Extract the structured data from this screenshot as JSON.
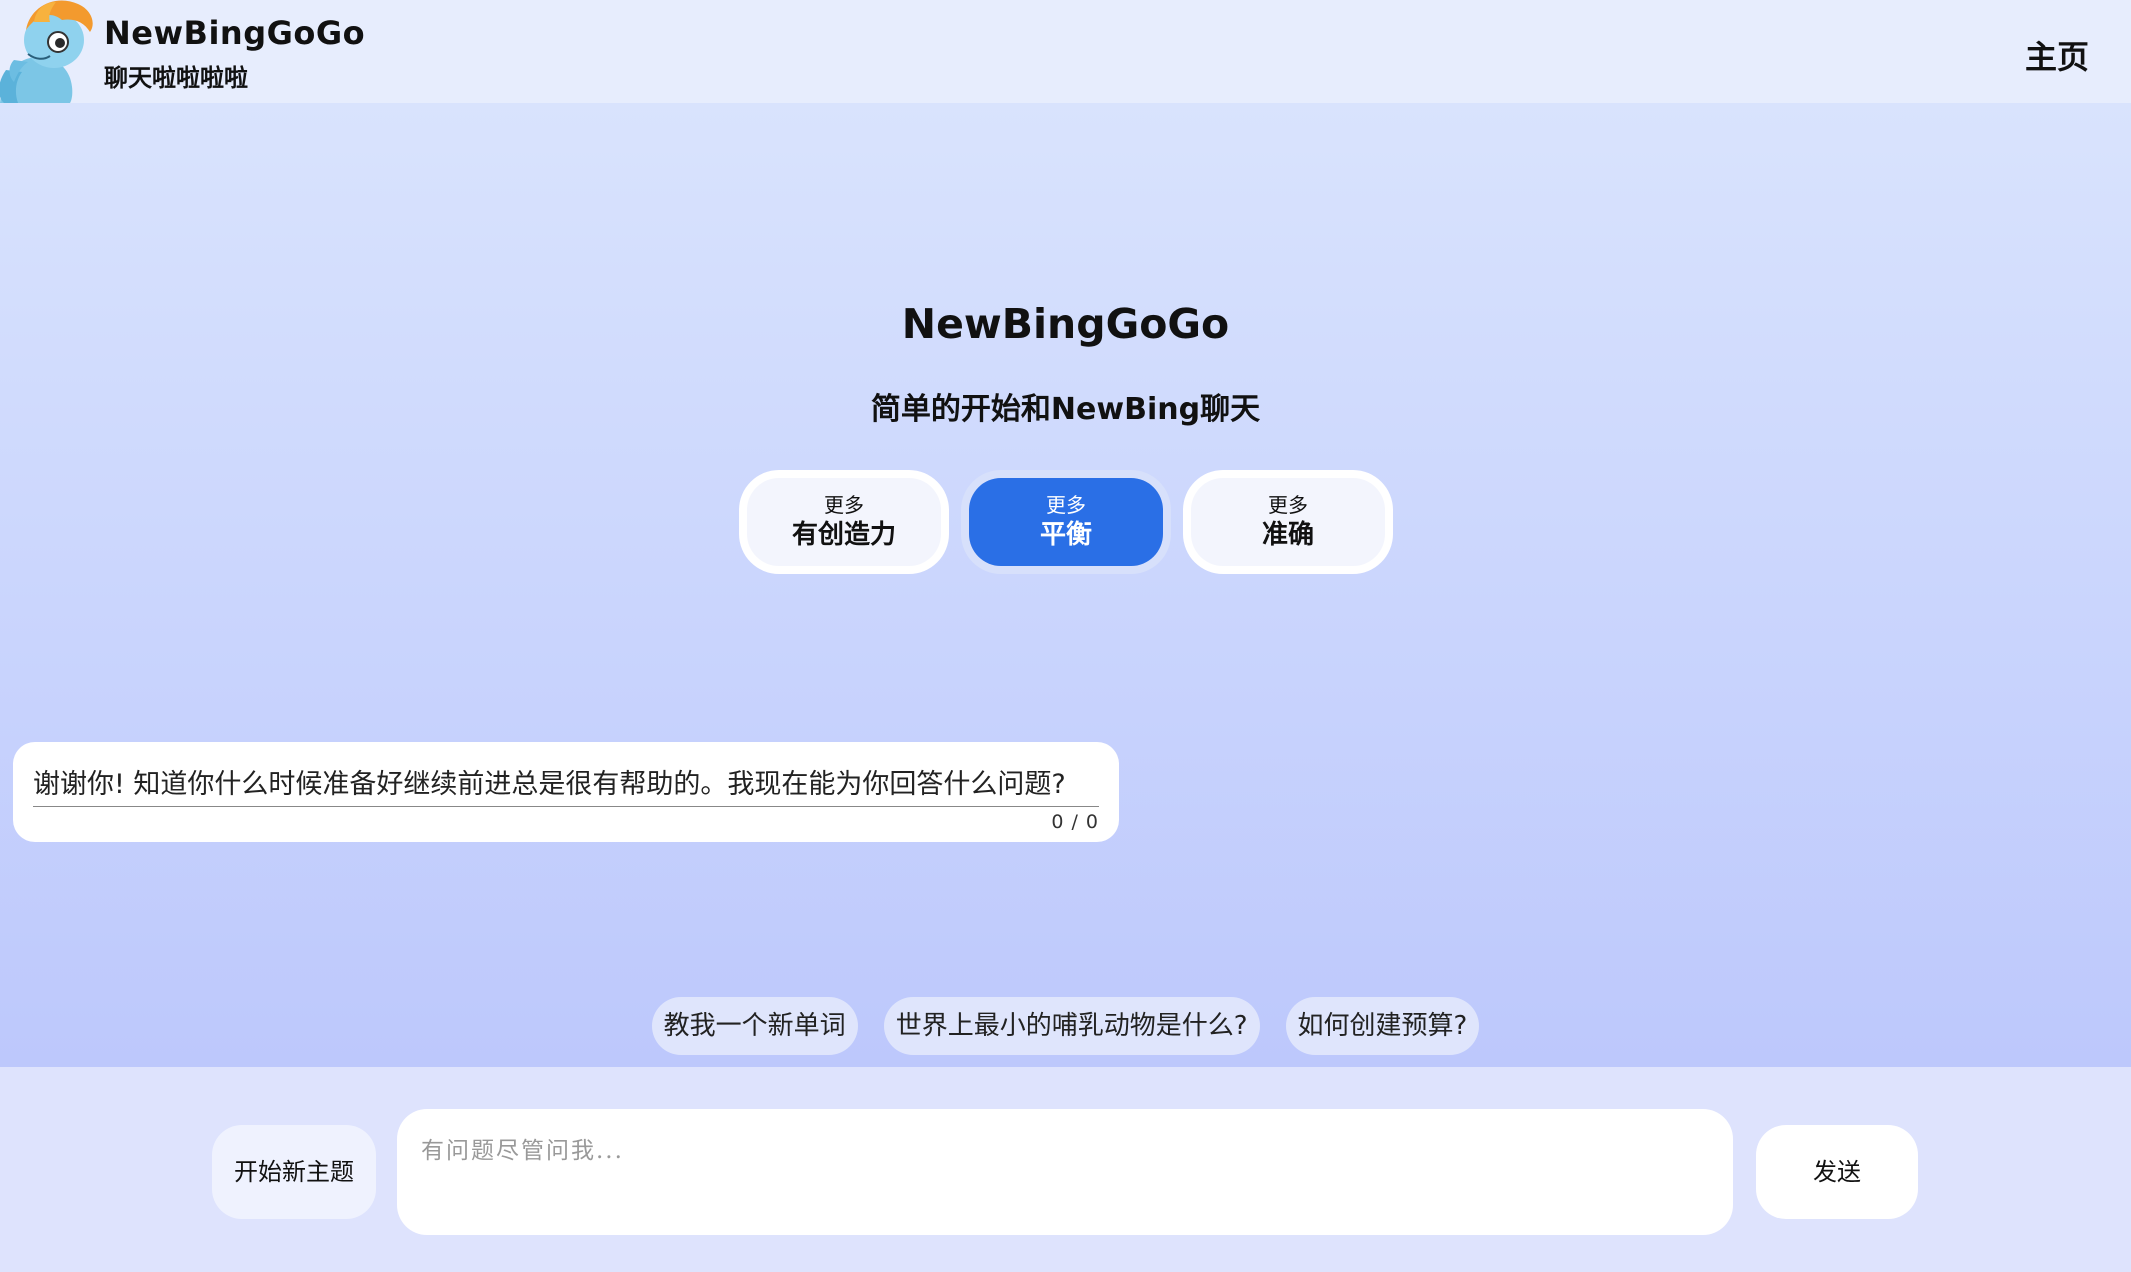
{
  "header": {
    "title": "NewBingGoGo",
    "subtitle": "聊天啦啦啦啦",
    "home_label": "主页"
  },
  "hero": {
    "title": "NewBingGoGo",
    "subtitle": "简单的开始和NewBing聊天"
  },
  "tones": [
    {
      "top": "更多",
      "label": "有创造力",
      "active": false
    },
    {
      "top": "更多",
      "label": "平衡",
      "active": true
    },
    {
      "top": "更多",
      "label": "准确",
      "active": false
    }
  ],
  "chat": {
    "message": "谢谢你! 知道你什么时候准备好继续前进总是很有帮助的。我现在能为你回答什么问题?",
    "count": "0 / 0"
  },
  "suggestions": [
    "教我一个新单词",
    "世界上最小的哺乳动物是什么?",
    "如何创建预算?"
  ],
  "composer": {
    "new_topic_label": "开始新主题",
    "placeholder": "有问题尽管问我...",
    "send_label": "发送"
  },
  "colors": {
    "accent": "#2a6fe6",
    "header_bg": "#e7edfd",
    "bottom_bg": "#dee3fd"
  }
}
